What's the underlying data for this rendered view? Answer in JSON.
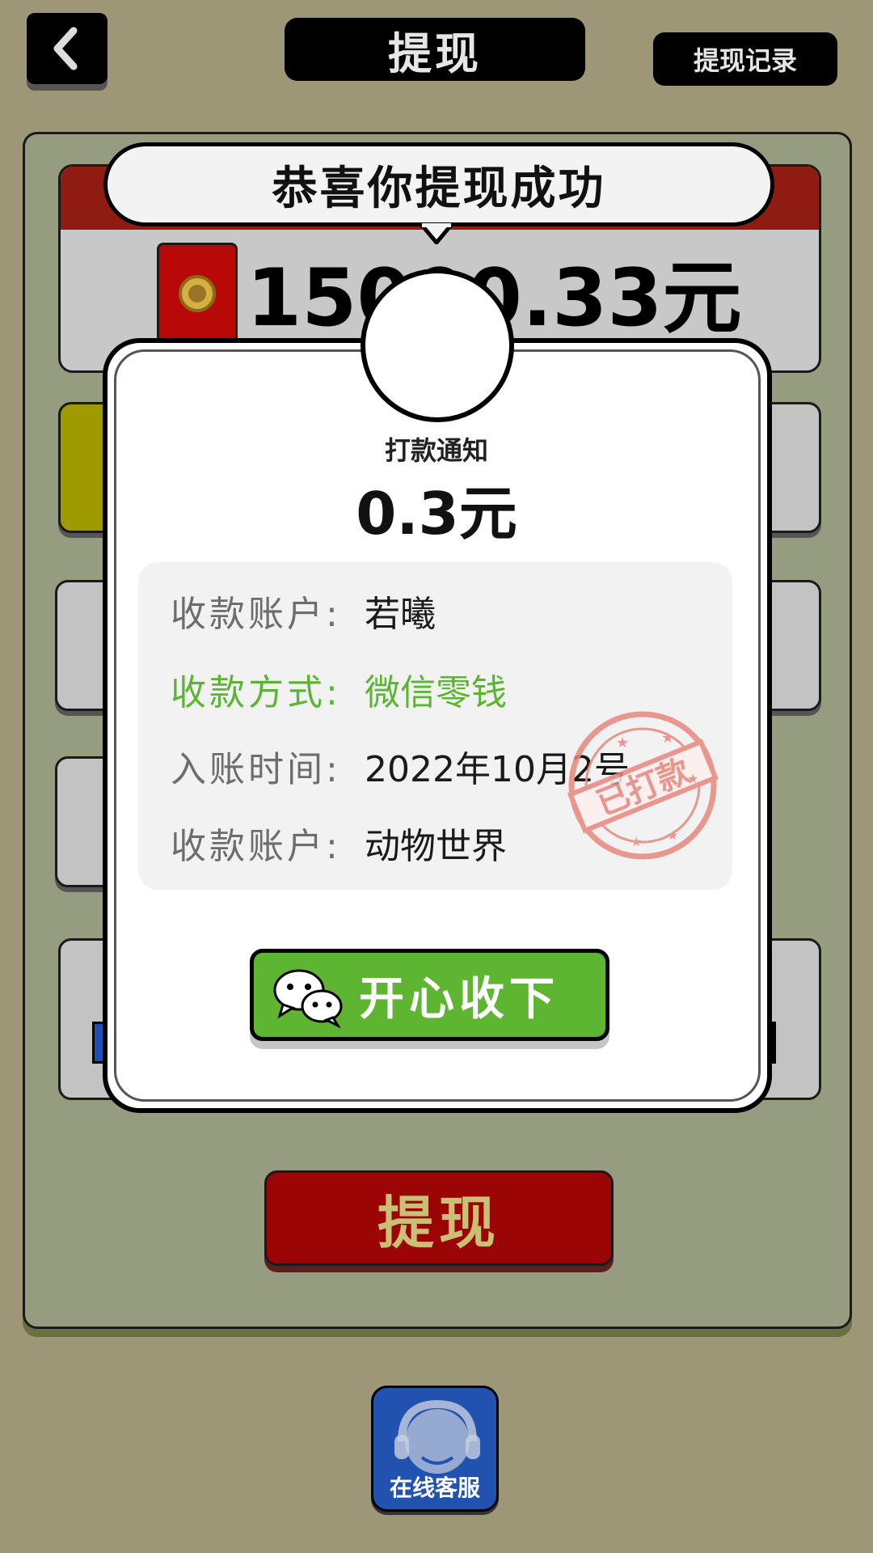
{
  "header": {
    "title": "提现",
    "record_label": "提现记录",
    "back_icon": "chevron-left-icon"
  },
  "balance": {
    "amount_text": "15000.33元"
  },
  "withdraw_button_label": "提现",
  "customer_service_label": "在线客服",
  "popup": {
    "bubble_text": "恭喜你提现成功",
    "notice_title": "打款通知",
    "amount": "0.3元",
    "rows": [
      {
        "key": "收款账户:",
        "value": "若曦"
      },
      {
        "key": "收款方式:",
        "value": "微信零钱"
      },
      {
        "key": "入账时间:",
        "value": "2022年10月2号"
      },
      {
        "key": "收款账户:",
        "value": "动物世界"
      }
    ],
    "stamp_text": "已打款",
    "confirm_label": "开心收下",
    "confirm_icon": "wechat-icon"
  },
  "colors": {
    "background": "#9d9677",
    "accent_green": "#5db531",
    "withdraw_red": "#9b0505",
    "stamp": "#e8877d"
  }
}
